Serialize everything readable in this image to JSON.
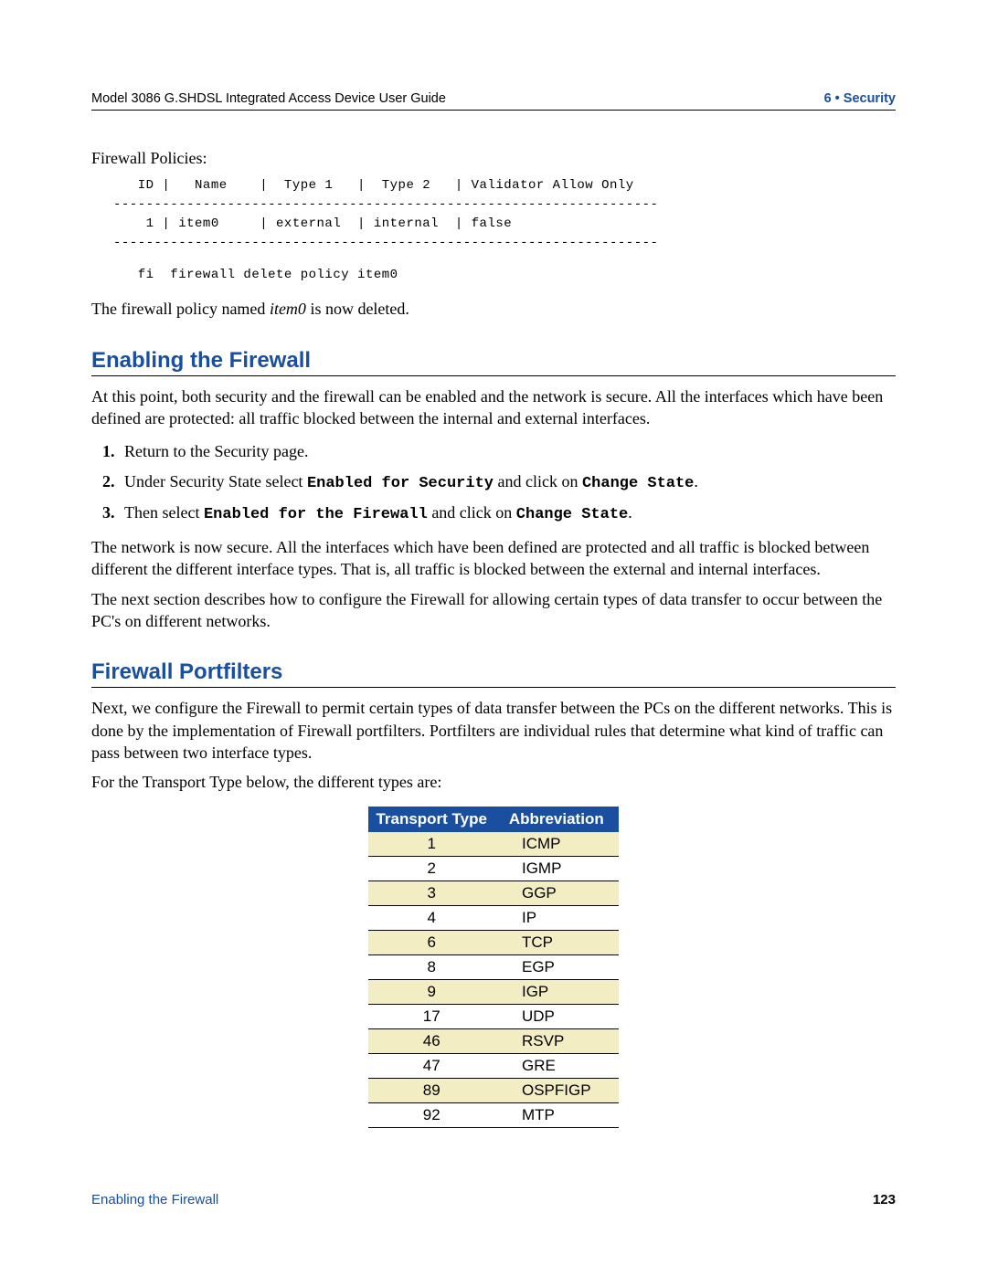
{
  "header": {
    "left": "Model 3086 G.SHDSL Integrated Access Device User Guide",
    "right": "6 • Security"
  },
  "intro_label": "Firewall Policies:",
  "policy_table_text": "   ID |   Name    |  Type 1   |  Type 2   | Validator Allow Only\n-------------------------------------------------------------------\n    1 | item0     | external  | internal  | false\n-------------------------------------------------------------------",
  "delete_cmd": "   fi  firewall delete policy item0",
  "deleted_sentence_pre": "The firewall policy named ",
  "deleted_sentence_em": "item0",
  "deleted_sentence_post": " is now deleted.",
  "section1": {
    "title": "Enabling the Firewall",
    "para1": "At this point, both security and the firewall can be enabled and the network is secure. All the interfaces which have been defined are protected:  all traffic blocked between the internal and external interfaces.",
    "steps": {
      "s1": "Return to the Security page.",
      "s2_pre": "Under Security State select ",
      "s2_code1": "Enabled for Security",
      "s2_mid": " and click on ",
      "s2_code2": "Change State",
      "s2_post": ".",
      "s3_pre": "Then select ",
      "s3_code1": "Enabled for the Firewall",
      "s3_mid": " and click on ",
      "s3_code2": "Change State",
      "s3_post": "."
    },
    "para2": "The network is now secure.  All the interfaces which have been defined are protected and all traffic is blocked between different the different interface types.   That is, all traffic is blocked between the external and internal interfaces.",
    "para3": "The next section describes how to configure the Firewall for allowing certain types of data transfer to occur between the PC's on different networks."
  },
  "section2": {
    "title": "Firewall Portfilters",
    "para1": "Next, we configure the Firewall to permit certain types of data transfer between the PCs on the different networks. This is done by the implementation of Firewall portfilters. Portfilters are individual rules that determine what kind of traffic can pass between two interface types.",
    "para2": "For the Transport Type below, the different types are:"
  },
  "chart_data": {
    "type": "table",
    "title": "",
    "columns": [
      "Transport Type",
      "Abbreviation"
    ],
    "rows": [
      {
        "num": "1",
        "abbr": "ICMP"
      },
      {
        "num": "2",
        "abbr": "IGMP"
      },
      {
        "num": "3",
        "abbr": "GGP"
      },
      {
        "num": "4",
        "abbr": "IP"
      },
      {
        "num": "6",
        "abbr": "TCP"
      },
      {
        "num": "8",
        "abbr": "EGP"
      },
      {
        "num": "9",
        "abbr": "IGP"
      },
      {
        "num": "17",
        "abbr": "UDP"
      },
      {
        "num": "46",
        "abbr": "RSVP"
      },
      {
        "num": "47",
        "abbr": "GRE"
      },
      {
        "num": "89",
        "abbr": "OSPFIGP"
      },
      {
        "num": "92",
        "abbr": "MTP"
      }
    ]
  },
  "footer": {
    "left": "Enabling the Firewall",
    "right": "123"
  }
}
